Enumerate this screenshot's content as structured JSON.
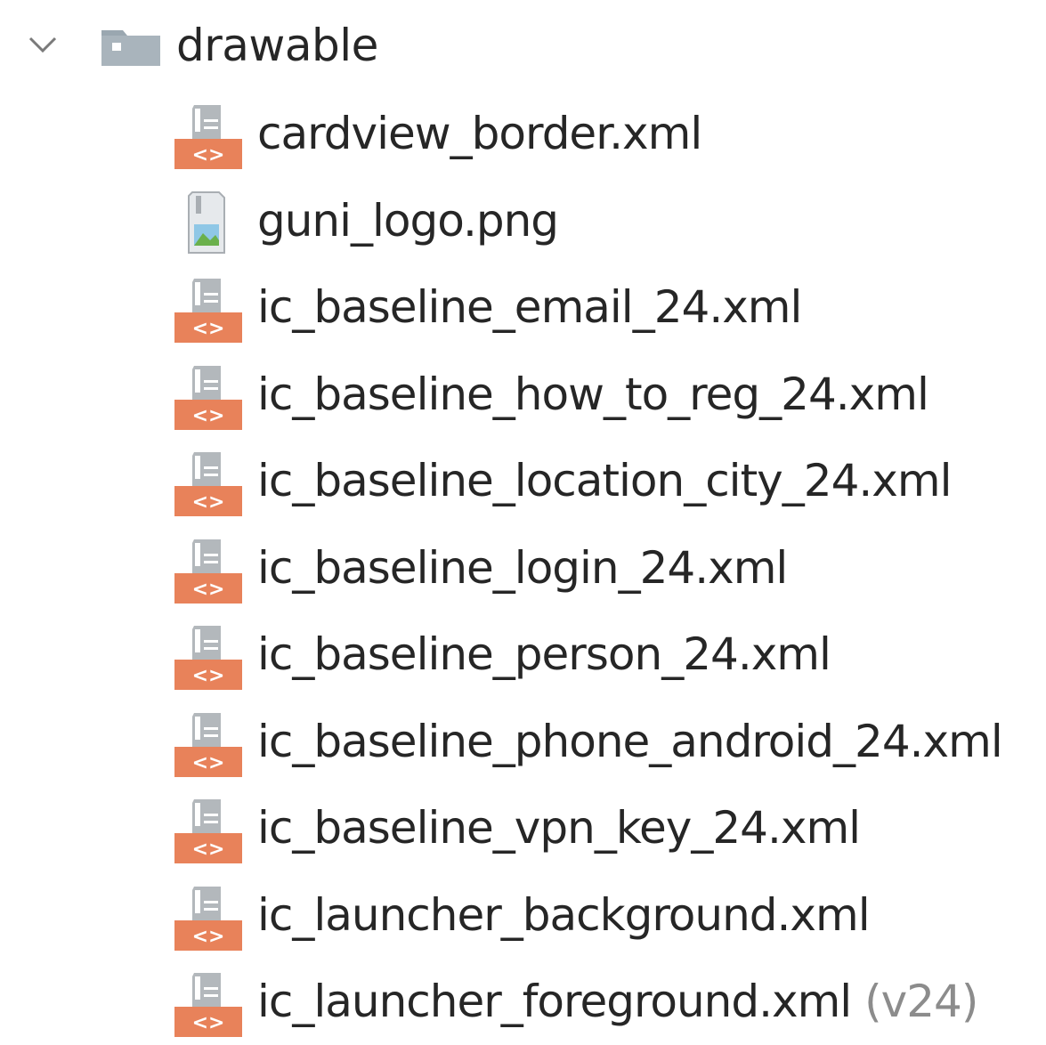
{
  "folder": {
    "label": "drawable",
    "icon": "folder-icon",
    "expanded": true,
    "chevron_icon": "chevron-down-icon"
  },
  "files": [
    {
      "name": "cardview_border.xml",
      "icon": "xml-file-icon",
      "qualifier": ""
    },
    {
      "name": "guni_logo.png",
      "icon": "image-file-icon",
      "qualifier": ""
    },
    {
      "name": "ic_baseline_email_24.xml",
      "icon": "xml-file-icon",
      "qualifier": ""
    },
    {
      "name": "ic_baseline_how_to_reg_24.xml",
      "icon": "xml-file-icon",
      "qualifier": ""
    },
    {
      "name": "ic_baseline_location_city_24.xml",
      "icon": "xml-file-icon",
      "qualifier": ""
    },
    {
      "name": "ic_baseline_login_24.xml",
      "icon": "xml-file-icon",
      "qualifier": ""
    },
    {
      "name": "ic_baseline_person_24.xml",
      "icon": "xml-file-icon",
      "qualifier": ""
    },
    {
      "name": "ic_baseline_phone_android_24.xml",
      "icon": "xml-file-icon",
      "qualifier": ""
    },
    {
      "name": "ic_baseline_vpn_key_24.xml",
      "icon": "xml-file-icon",
      "qualifier": ""
    },
    {
      "name": "ic_launcher_background.xml",
      "icon": "xml-file-icon",
      "qualifier": ""
    },
    {
      "name": "ic_launcher_foreground.xml",
      "icon": "xml-file-icon",
      "qualifier": "(v24)"
    }
  ],
  "colors": {
    "text": "#262626",
    "qualifier": "#8c8c8c",
    "xml_badge": "#e8825a",
    "folder": "#9aa7b0",
    "file_page": "#b0b5b9"
  }
}
